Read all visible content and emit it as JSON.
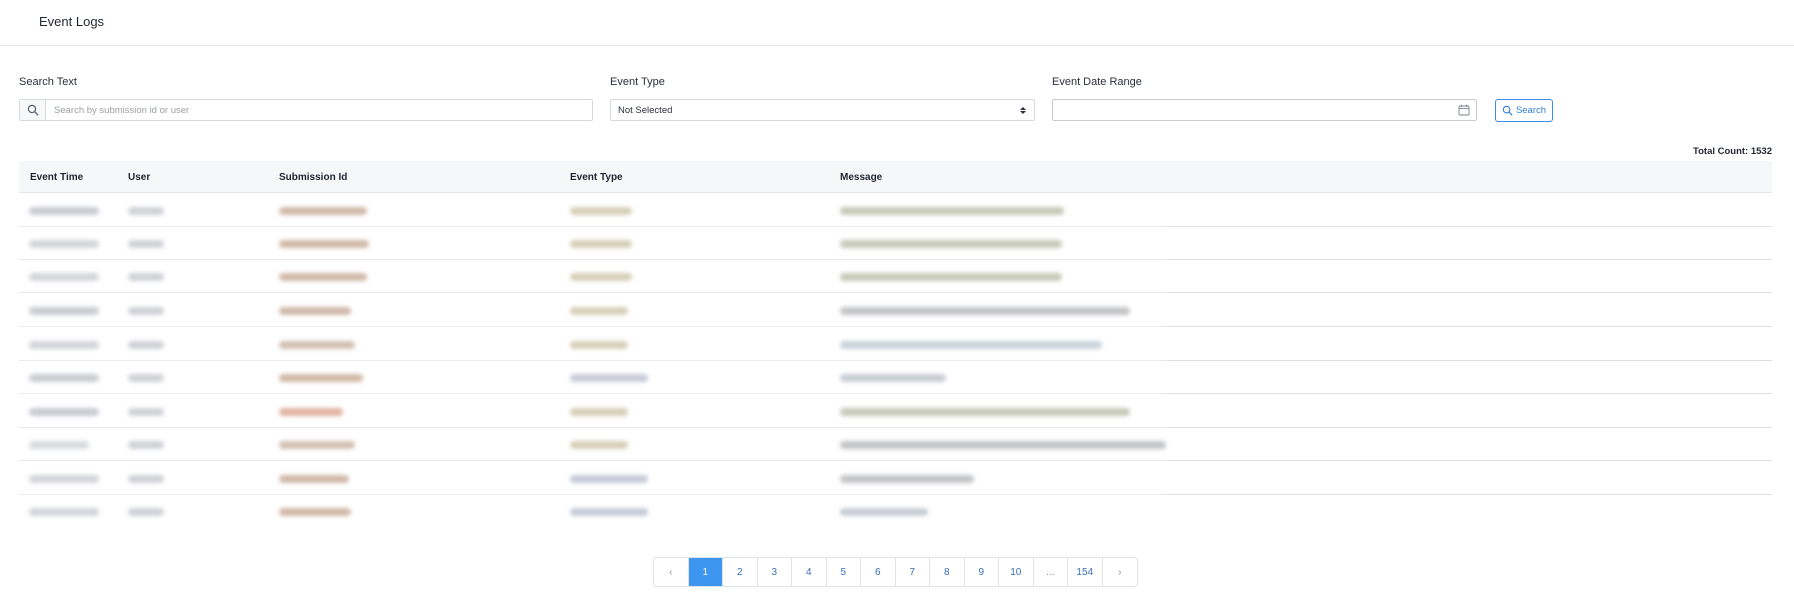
{
  "header": {
    "title": "Event Logs"
  },
  "filters": {
    "search_label": "Search Text",
    "search_placeholder": "Search by submission id or user",
    "event_type_label": "Event Type",
    "event_type_value": "Not Selected",
    "date_range_label": "Event Date Range",
    "search_button_label": "Search"
  },
  "total_count": "Total Count: 1532",
  "table": {
    "columns": [
      "Event Time",
      "User",
      "Submission Id",
      "Event Type",
      "Message"
    ]
  },
  "pagination": {
    "prev": "‹",
    "next": "›",
    "pages": [
      "1",
      "2",
      "3",
      "4",
      "5",
      "6",
      "7",
      "8",
      "9",
      "10",
      "...",
      "154"
    ],
    "active": "1"
  },
  "colors": {
    "accent": "#3d96f0",
    "button_border": "#3d8ee8",
    "header_bg": "#f6f7f8",
    "border": "#d6d9de"
  }
}
